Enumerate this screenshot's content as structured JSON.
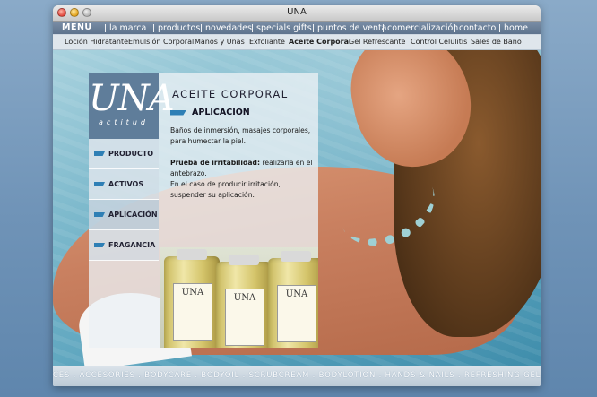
{
  "window": {
    "title": "UNA"
  },
  "topnav": {
    "menu_label": "MENU",
    "items": [
      "la marca",
      "productos",
      "novedades",
      "specials gifts",
      "puntos de venta",
      "comercialización",
      "contacto",
      "home"
    ]
  },
  "subnav": {
    "items": [
      "Loción Hidratante",
      "Emulsión Corporal",
      "Manos y Uñas",
      "Exfoliante",
      "Aceite Corporal",
      "Gel Refrescante",
      "Control Celulitis",
      "Sales de Baño"
    ],
    "active": "Aceite Corporal"
  },
  "logo": {
    "word": "UNA",
    "sub": "actitud"
  },
  "side_nav": {
    "items": [
      "PRODUCTO",
      "ACTIVOS",
      "APLICACIÓN",
      "FRAGANCIA"
    ],
    "active": "APLICACIÓN"
  },
  "content": {
    "title": "ACEITE CORPORAL",
    "section": "APLICACION",
    "p1": "Baños de inmersión, masajes corporales, para humectar la piel.",
    "p2_label": "Prueba de irritabilidad:",
    "p2_text": " realizarla en el antebrazo.",
    "p3": "En el caso de producir irritación, suspender su aplicación."
  },
  "bottle_label": "UNA",
  "ticker": "CES . ACCESORIES . BODYCARE . BODYOIL . SCRUBCREAM . BODYLOTION . HANDS & NAILS . REFRESHING GEL . CONTROL CELLU",
  "colors": {
    "nav_bg": "#6a7f98",
    "logo_bg": "#5f7d9a",
    "accent_flag": "#2e7fb5"
  }
}
